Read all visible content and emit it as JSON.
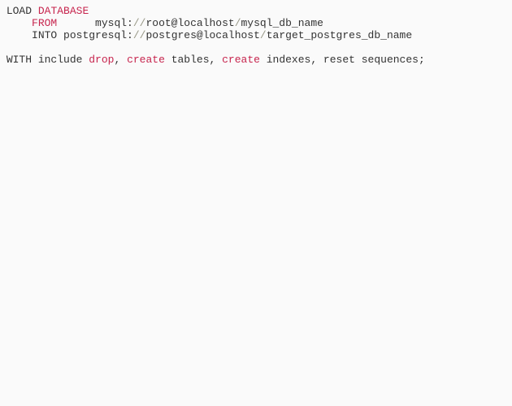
{
  "code": {
    "indent1": " ",
    "indent5": "     ",
    "load": "LOAD",
    "database": "DATABASE",
    "from": "FROM",
    "from_gap": "      ",
    "mysql_scheme": "mysql:",
    "slashslash": "//",
    "root_at_localhost": "root@localhost",
    "slash": "/",
    "mysql_db": "mysql_db_name",
    "into": "INTO",
    "pg_scheme": "postgresql:",
    "pg_user_host": "postgres@localhost",
    "pg_db": "target_postgres_db_name",
    "with_include": "WITH include",
    "drop": "drop",
    "comma_space": ", ",
    "create": "create",
    "tables_comma": " tables, ",
    "indexes_reset": " indexes, reset sequences;"
  }
}
